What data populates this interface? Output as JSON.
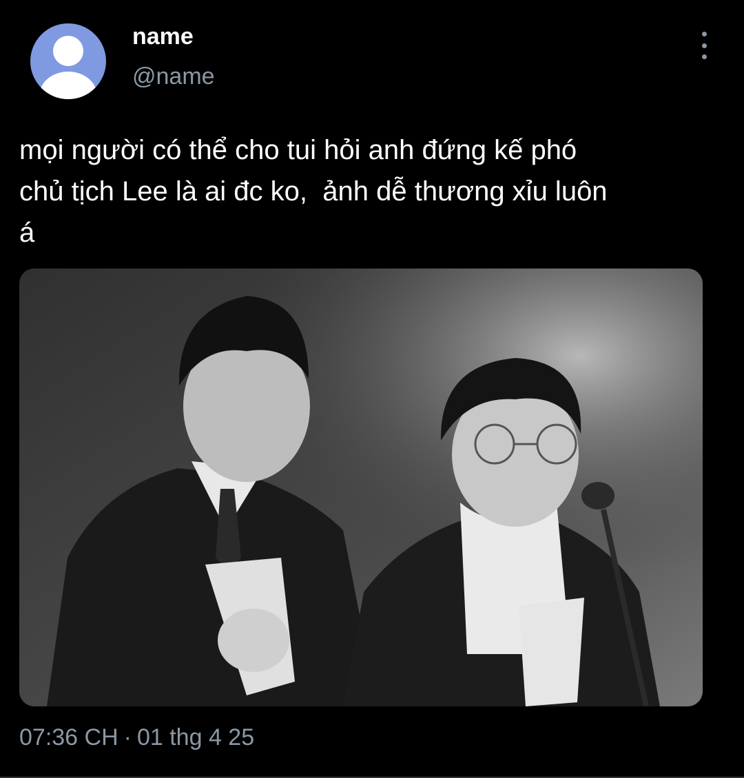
{
  "user": {
    "display_name": "name",
    "handle": "@name",
    "avatar_icon": "default-user-avatar-icon",
    "avatar_color": "#7f9ae0"
  },
  "tweet": {
    "text": "mọi người có thể cho tui hỏi anh đứng kế phó\nchủ tịch Lee là ai đc ko,  ảnh dễ thương xỉu luôn\ná",
    "photo_icon": "photo-two-men-on-stage-black-and-white",
    "time": "07:36 CH",
    "separator": "·",
    "date": "01 thg 4 25"
  },
  "menu": {
    "icon": "more-vertical-icon"
  },
  "colors": {
    "background": "#000000",
    "text": "#ffffff",
    "secondary_text": "#8b98a5"
  }
}
